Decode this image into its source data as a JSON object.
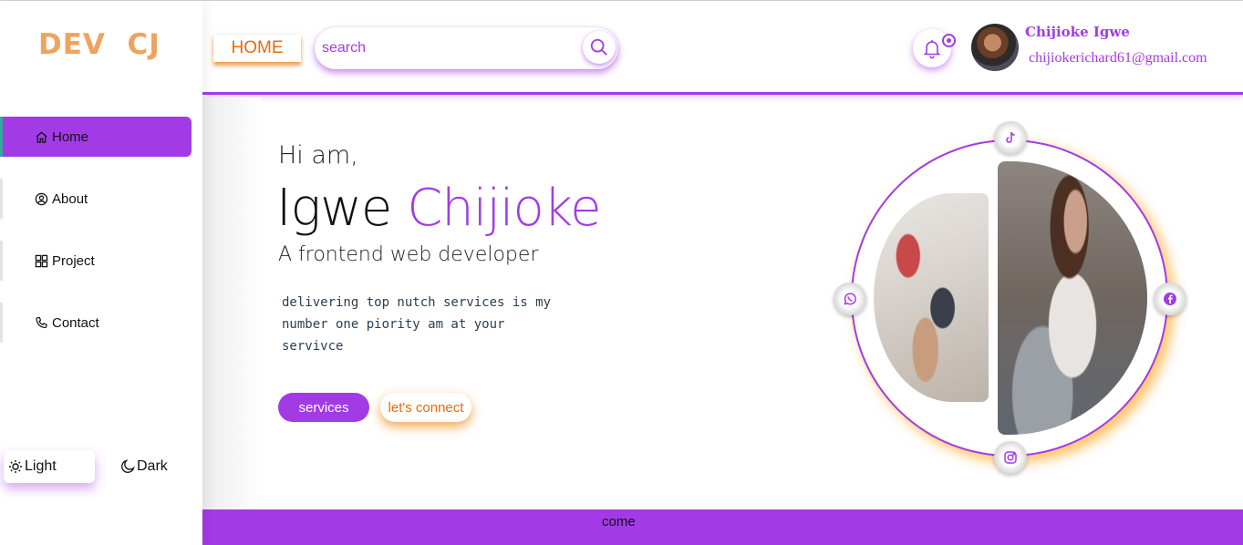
{
  "app": {
    "logo": "DEV  CJ"
  },
  "sidebar": {
    "items": [
      {
        "label": "Home",
        "icon": "home-icon",
        "active": true
      },
      {
        "label": "About",
        "icon": "user-circle-icon",
        "active": false
      },
      {
        "label": "Project",
        "icon": "grid-icon",
        "active": false
      },
      {
        "label": "Contact",
        "icon": "phone-icon",
        "active": false
      }
    ],
    "theme": {
      "light_label": "Light",
      "dark_label": "Dark",
      "selected": "Light"
    }
  },
  "header": {
    "home_button": "HOME",
    "search": {
      "placeholder": "search",
      "value": ""
    },
    "notification_icon": "bell-icon",
    "user": {
      "name": "Chijioke Igwe",
      "email": "chijiokerichard61@gmail.com"
    }
  },
  "hero": {
    "greeting": "Hi am,",
    "first_name": "Igwe",
    "last_name": "Chijioke",
    "role": "A frontend web developer",
    "description": "delivering top nutch services is my number one piority am at your servivce",
    "buttons": {
      "services": "services",
      "connect": "let's connect"
    },
    "social_icons": [
      "tiktok-icon",
      "whatsapp-icon",
      "facebook-icon",
      "instagram-icon"
    ]
  },
  "footer": {
    "text": "come"
  },
  "colors": {
    "accent": "#a23be6",
    "orange": "#e8690f",
    "logo": "#f0a35e",
    "background": "#ffffff"
  }
}
